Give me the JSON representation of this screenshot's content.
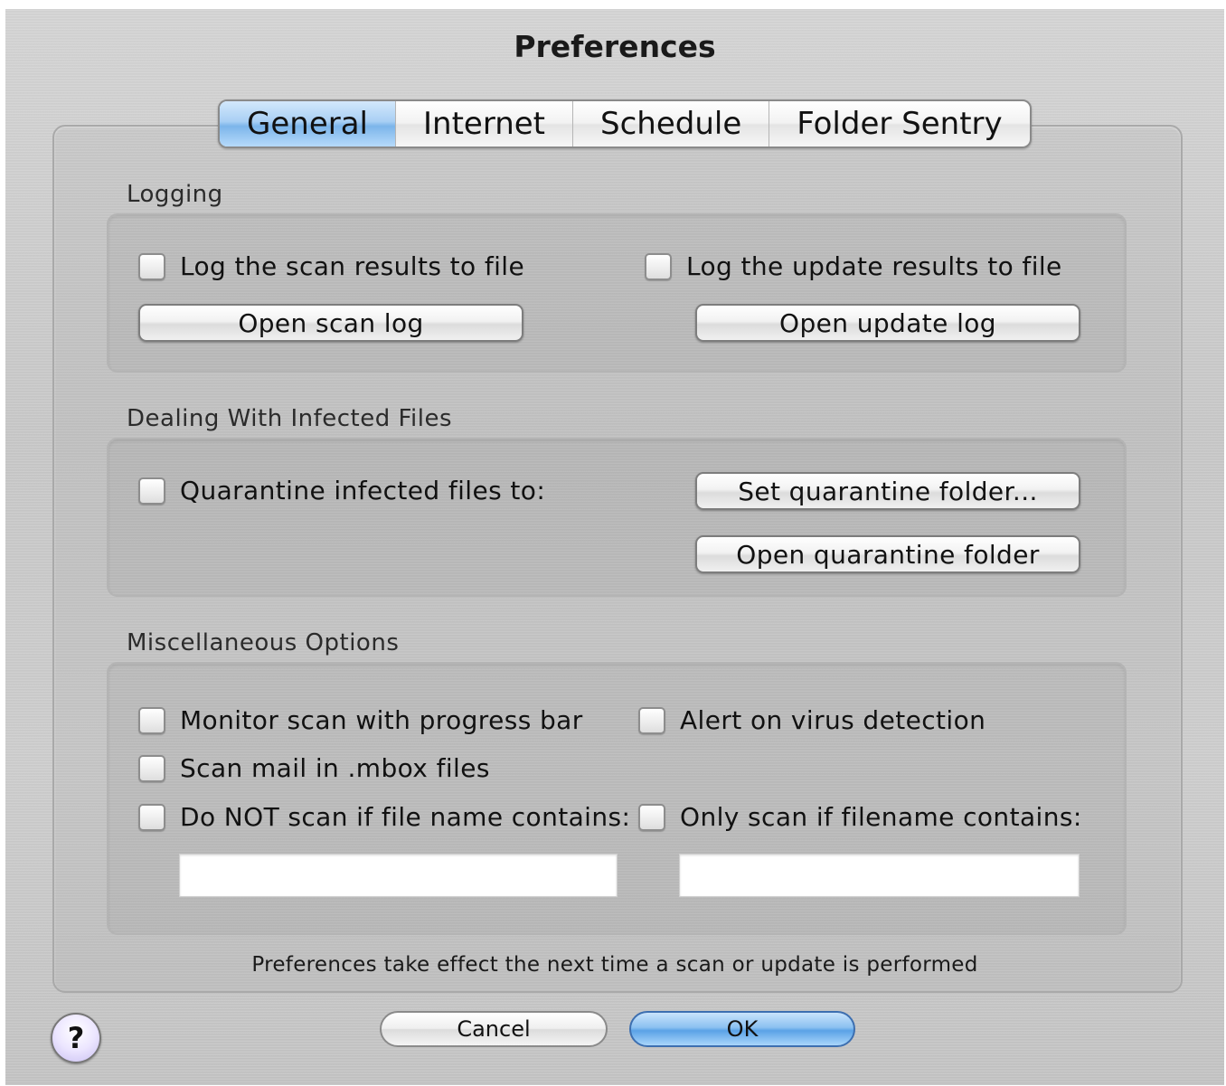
{
  "window": {
    "title": "Preferences"
  },
  "tabs": [
    {
      "label": "General",
      "active": true
    },
    {
      "label": "Internet",
      "active": false
    },
    {
      "label": "Schedule",
      "active": false
    },
    {
      "label": "Folder Sentry",
      "active": false
    }
  ],
  "logging": {
    "title": "Logging",
    "scan_checkbox": {
      "label": "Log the scan results to file",
      "checked": false
    },
    "update_checkbox": {
      "label": "Log the update results to file",
      "checked": false
    },
    "open_scan_log": "Open scan log",
    "open_update_log": "Open update log"
  },
  "infected": {
    "title": "Dealing With Infected Files",
    "quarantine_checkbox": {
      "label": "Quarantine infected files to:",
      "checked": false
    },
    "set_quarantine": "Set quarantine folder...",
    "open_quarantine": "Open quarantine folder"
  },
  "misc": {
    "title": "Miscellaneous Options",
    "monitor_progress": {
      "label": "Monitor scan with progress bar",
      "checked": false
    },
    "alert_virus": {
      "label": "Alert on virus detection",
      "checked": false
    },
    "scan_mbox": {
      "label": "Scan mail in .mbox files",
      "checked": false
    },
    "do_not_scan": {
      "label": "Do NOT scan if file name contains:",
      "checked": false,
      "value": ""
    },
    "only_scan": {
      "label": "Only scan if filename contains:",
      "checked": false,
      "value": ""
    }
  },
  "footer": {
    "note": "Preferences take effect the next time a scan or update is performed",
    "cancel": "Cancel",
    "ok": "OK",
    "help": "?"
  },
  "colors": {
    "window_bg": "#c9c9c9",
    "active_tab": "#8cc1f1",
    "default_button": "#5aa2e6"
  },
  "icons": {
    "help": "question-mark-icon"
  }
}
